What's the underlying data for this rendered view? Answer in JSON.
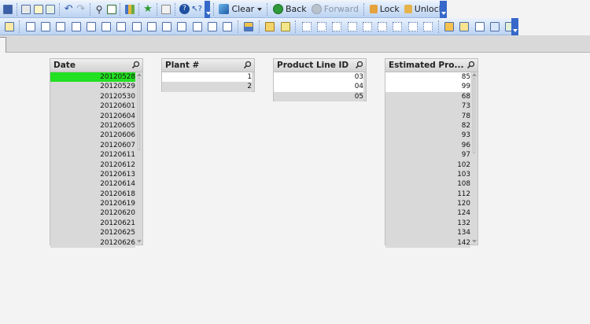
{
  "toolbar1": {
    "clear_label": "Clear",
    "back_label": "Back",
    "forward_label": "Forward",
    "lock_label": "Lock",
    "unlock_label": "Unlock",
    "icons": [
      "save-icon",
      "print-icon",
      "edit-icon",
      "export-icon",
      "undo-icon",
      "redo-icon",
      "search-icon",
      "checkbox-icon",
      "chart-icon",
      "bookmark-star-icon",
      "properties-icon",
      "help-icon",
      "whats-this-icon"
    ]
  },
  "toolbar2": {
    "icons": [
      "new-sheet-icon",
      "list-box-icon",
      "statistics-box-icon",
      "multi-box-icon",
      "table-box-icon",
      "chart-object-icon",
      "input-box-icon",
      "current-selections-icon",
      "button-icon",
      "text-object-icon",
      "line-arrow-icon",
      "slider-icon",
      "search-object-icon",
      "bookmark-object-icon",
      "container-icon",
      "design-grid-icon",
      "format-painter-icon",
      "align-left-icon",
      "align-center-icon",
      "align-right-icon",
      "align-top-icon",
      "align-middle-icon",
      "align-bottom-icon",
      "space-horizontal-icon",
      "space-vertical-icon",
      "adjust-left-icon",
      "adjust-top-icon",
      "new-sheet-object-icon",
      "add-sheet-icon",
      "sheet-properties-icon",
      "document-properties-icon",
      "reload-icon"
    ]
  },
  "listboxes": {
    "date": {
      "title": "Date",
      "items": [
        {
          "v": "20120528",
          "s": "sel"
        },
        {
          "v": "20120529",
          "s": "gray"
        },
        {
          "v": "20120530",
          "s": "gray"
        },
        {
          "v": "20120601",
          "s": "gray"
        },
        {
          "v": "20120604",
          "s": "gray"
        },
        {
          "v": "20120605",
          "s": "gray"
        },
        {
          "v": "20120606",
          "s": "gray"
        },
        {
          "v": "20120607",
          "s": "gray"
        },
        {
          "v": "20120611",
          "s": "gray"
        },
        {
          "v": "20120612",
          "s": "gray"
        },
        {
          "v": "20120613",
          "s": "gray"
        },
        {
          "v": "20120614",
          "s": "gray"
        },
        {
          "v": "20120618",
          "s": "gray"
        },
        {
          "v": "20120619",
          "s": "gray"
        },
        {
          "v": "20120620",
          "s": "gray"
        },
        {
          "v": "20120621",
          "s": "gray"
        },
        {
          "v": "20120625",
          "s": "gray"
        },
        {
          "v": "20120626",
          "s": "gray"
        }
      ]
    },
    "plant": {
      "title": "Plant #",
      "items": [
        {
          "v": "1",
          "s": "white"
        },
        {
          "v": "2",
          "s": "gray"
        }
      ]
    },
    "product_line": {
      "title": "Product Line ID",
      "items": [
        {
          "v": "03",
          "s": "white"
        },
        {
          "v": "04",
          "s": "white"
        },
        {
          "v": "05",
          "s": "gray"
        }
      ]
    },
    "estimated": {
      "title": "Estimated Pro...",
      "items": [
        {
          "v": "85",
          "s": "white"
        },
        {
          "v": "99",
          "s": "white"
        },
        {
          "v": "68",
          "s": "gray"
        },
        {
          "v": "73",
          "s": "gray"
        },
        {
          "v": "78",
          "s": "gray"
        },
        {
          "v": "82",
          "s": "gray"
        },
        {
          "v": "93",
          "s": "gray"
        },
        {
          "v": "96",
          "s": "gray"
        },
        {
          "v": "97",
          "s": "gray"
        },
        {
          "v": "102",
          "s": "gray"
        },
        {
          "v": "103",
          "s": "gray"
        },
        {
          "v": "108",
          "s": "gray"
        },
        {
          "v": "112",
          "s": "gray"
        },
        {
          "v": "120",
          "s": "gray"
        },
        {
          "v": "124",
          "s": "gray"
        },
        {
          "v": "132",
          "s": "gray"
        },
        {
          "v": "134",
          "s": "gray"
        },
        {
          "v": "142",
          "s": "gray"
        }
      ]
    }
  },
  "colors": {
    "selected": "#22e022",
    "excluded": "#d9d9d9",
    "possible": "#ffffff",
    "toolbar_accent": "#3568c9"
  }
}
